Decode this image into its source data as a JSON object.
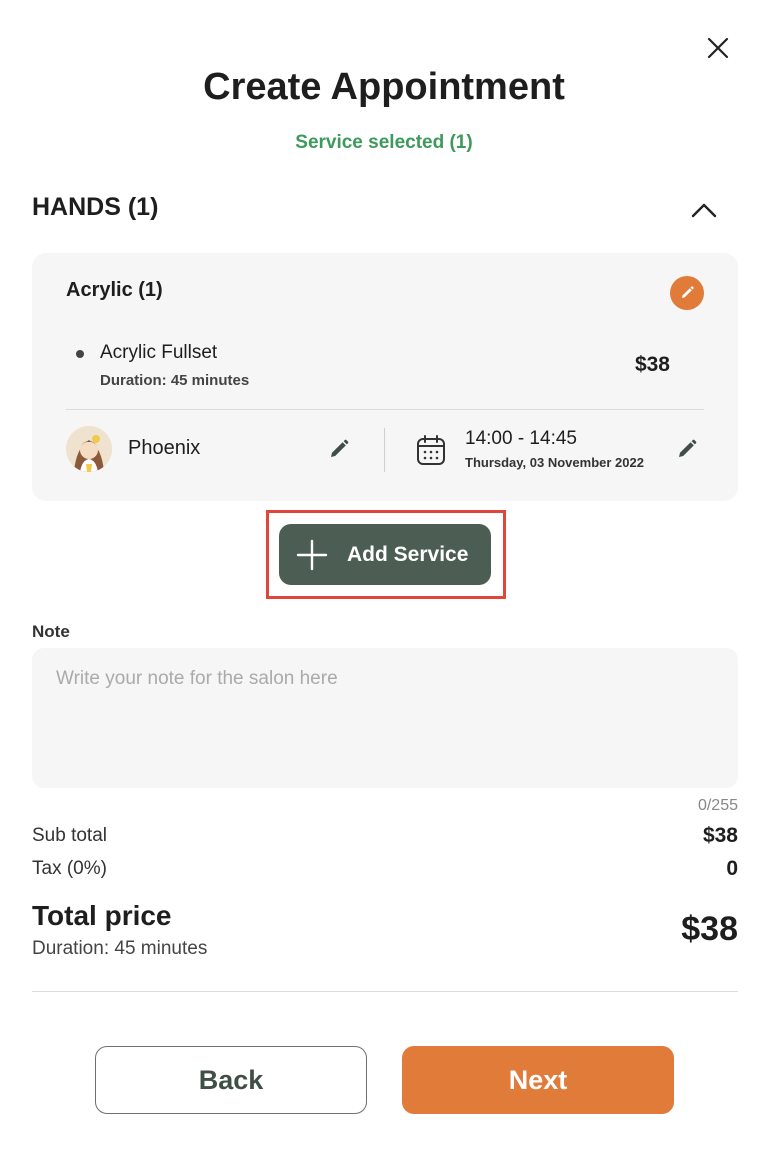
{
  "header": {
    "title": "Create Appointment",
    "subtitle": "Service selected (1)"
  },
  "category": {
    "title": "HANDS (1)",
    "expanded": true
  },
  "service_group": {
    "title": "Acrylic (1)",
    "items": [
      {
        "name": "Acrylic Fullset",
        "duration": "Duration: 45 minutes",
        "price": "$38"
      }
    ],
    "staff": {
      "name": "Phoenix"
    },
    "time": {
      "range": "14:00 - 14:45",
      "date": "Thursday, 03 November 2022"
    }
  },
  "add_service": {
    "label": "Add Service"
  },
  "note": {
    "label": "Note",
    "placeholder": "Write your note for the salon here",
    "value": "",
    "count": "0/255"
  },
  "totals": {
    "subtotal_label": "Sub total",
    "subtotal_value": "$38",
    "tax_label": "Tax (0%)",
    "tax_value": "0",
    "total_label": "Total price",
    "total_duration": "Duration: 45 minutes",
    "total_value": "$38"
  },
  "footer": {
    "back_label": "Back",
    "next_label": "Next"
  },
  "colors": {
    "accent_orange": "#e07b39",
    "primary_green": "#4c5e54",
    "success_green": "#3e9a5b",
    "highlight_red": "#e0463a"
  },
  "icons": {
    "close": "close-icon",
    "collapse": "chevron-up-icon",
    "edit": "pencil-icon",
    "calendar": "calendar-icon",
    "add": "plus-icon"
  }
}
